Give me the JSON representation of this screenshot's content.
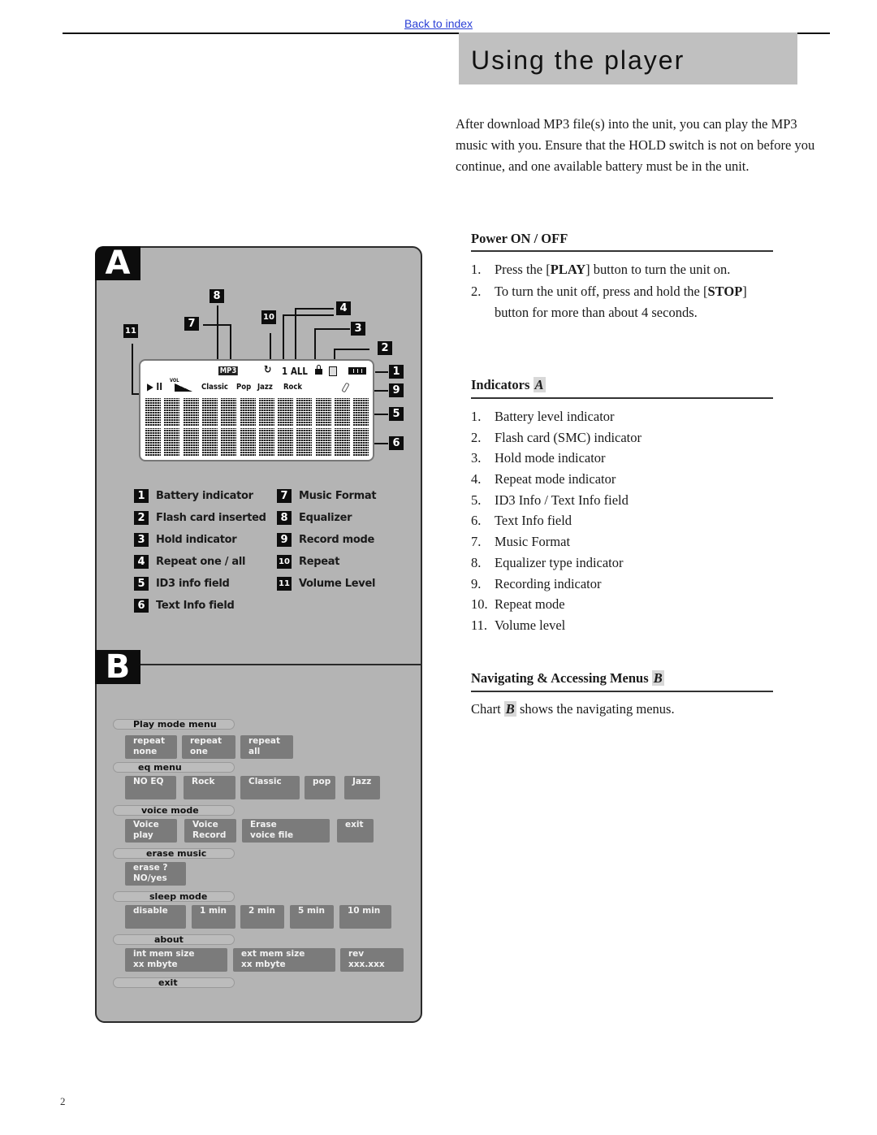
{
  "header": {
    "back_link": "Back to index",
    "title": "Using the player"
  },
  "intro": "After download MP3 file(s) into the unit, you can play the MP3 music with you. Ensure that the HOLD switch is not on before you continue, and one available battery must be in the unit.",
  "power": {
    "heading": "Power ON / OFF",
    "steps": [
      {
        "num": "1.",
        "pre": "Press the [",
        "bold": "PLAY",
        "post": "] button to turn the unit on."
      },
      {
        "num": "2.",
        "pre": "To turn the unit off, press and hold the [",
        "bold": "STOP",
        "post": "]",
        "cont": "button for more than about 4 seconds."
      }
    ]
  },
  "indicators": {
    "heading": "Indicators",
    "ref": "A",
    "items": [
      {
        "num": "1.",
        "text": "Battery level indicator"
      },
      {
        "num": "2.",
        "text": "Flash card (SMC) indicator"
      },
      {
        "num": "3.",
        "text": "Hold mode indicator"
      },
      {
        "num": "4.",
        "text": "Repeat mode indicator"
      },
      {
        "num": "5.",
        "text": "ID3 Info / Text Info field"
      },
      {
        "num": "6.",
        "text": "Text Info field"
      },
      {
        "num": "7.",
        "text": "Music Format"
      },
      {
        "num": "8.",
        "text": "Equalizer type indicator"
      },
      {
        "num": "9.",
        "text": "Recording indicator"
      },
      {
        "num": "10.",
        "text": "Repeat mode"
      },
      {
        "num": "11.",
        "text": "Volume level"
      }
    ]
  },
  "navigating": {
    "heading": "Navigating & Accessing Menus",
    "ref": "B",
    "text_pre": "Chart",
    "text_ref": "B",
    "text_post": "shows the navigating menus."
  },
  "diagram": {
    "panel_a_label": "A",
    "panel_b_label": "B",
    "lcd": {
      "play_pause": "▶ II",
      "vol": "VOL",
      "eq_labels": [
        "Classic",
        "Pop",
        "Jazz",
        "Rock"
      ],
      "format": "MP3",
      "repeat_icon": "↻",
      "repeat_one": "1",
      "repeat_all": "ALL",
      "hold_icon": "lock-icon",
      "card_icon": "sd-card-icon",
      "battery_icon": "battery-icon",
      "mic_icon": "microphone-icon"
    },
    "callouts": [
      "1",
      "2",
      "3",
      "4",
      "5",
      "6",
      "7",
      "8",
      "9",
      "10",
      "11"
    ],
    "legend_left": [
      {
        "num": "1",
        "text": "Battery indicator"
      },
      {
        "num": "2",
        "text": "Flash card inserted"
      },
      {
        "num": "3",
        "text": "Hold indicator"
      },
      {
        "num": "4",
        "text": "Repeat one / all"
      },
      {
        "num": "5",
        "text": "ID3 info field"
      },
      {
        "num": "6",
        "text": "Text Info field"
      }
    ],
    "legend_right": [
      {
        "num": "7",
        "text": "Music Format"
      },
      {
        "num": "8",
        "text": "Equalizer"
      },
      {
        "num": "9",
        "text": "Record mode"
      },
      {
        "num": "10",
        "text": "Repeat"
      },
      {
        "num": "11",
        "text": "Volume Level"
      }
    ],
    "menus": [
      {
        "name": "Play mode menu",
        "options": [
          "repeat\nnone",
          "repeat\none",
          "repeat\nall"
        ]
      },
      {
        "name": "eq menu",
        "options": [
          "NO EQ",
          "Rock",
          "Classic",
          "pop",
          "Jazz"
        ]
      },
      {
        "name": "voice mode",
        "options": [
          "Voice\nplay",
          "Voice\nRecord",
          "Erase\nvoice file",
          "exit"
        ]
      },
      {
        "name": "erase music",
        "options": [
          "erase ?\nNO/yes"
        ]
      },
      {
        "name": "sleep mode",
        "options": [
          "disable",
          "1 min",
          "2 min",
          "5 min",
          "10 min"
        ]
      },
      {
        "name": "about",
        "options": [
          "int mem size\nxx mbyte",
          "ext mem size\nxx mbyte",
          "rev\nxxx.xxx"
        ]
      },
      {
        "name": "exit",
        "options": []
      }
    ]
  },
  "footer": {
    "page_number": "2"
  }
}
